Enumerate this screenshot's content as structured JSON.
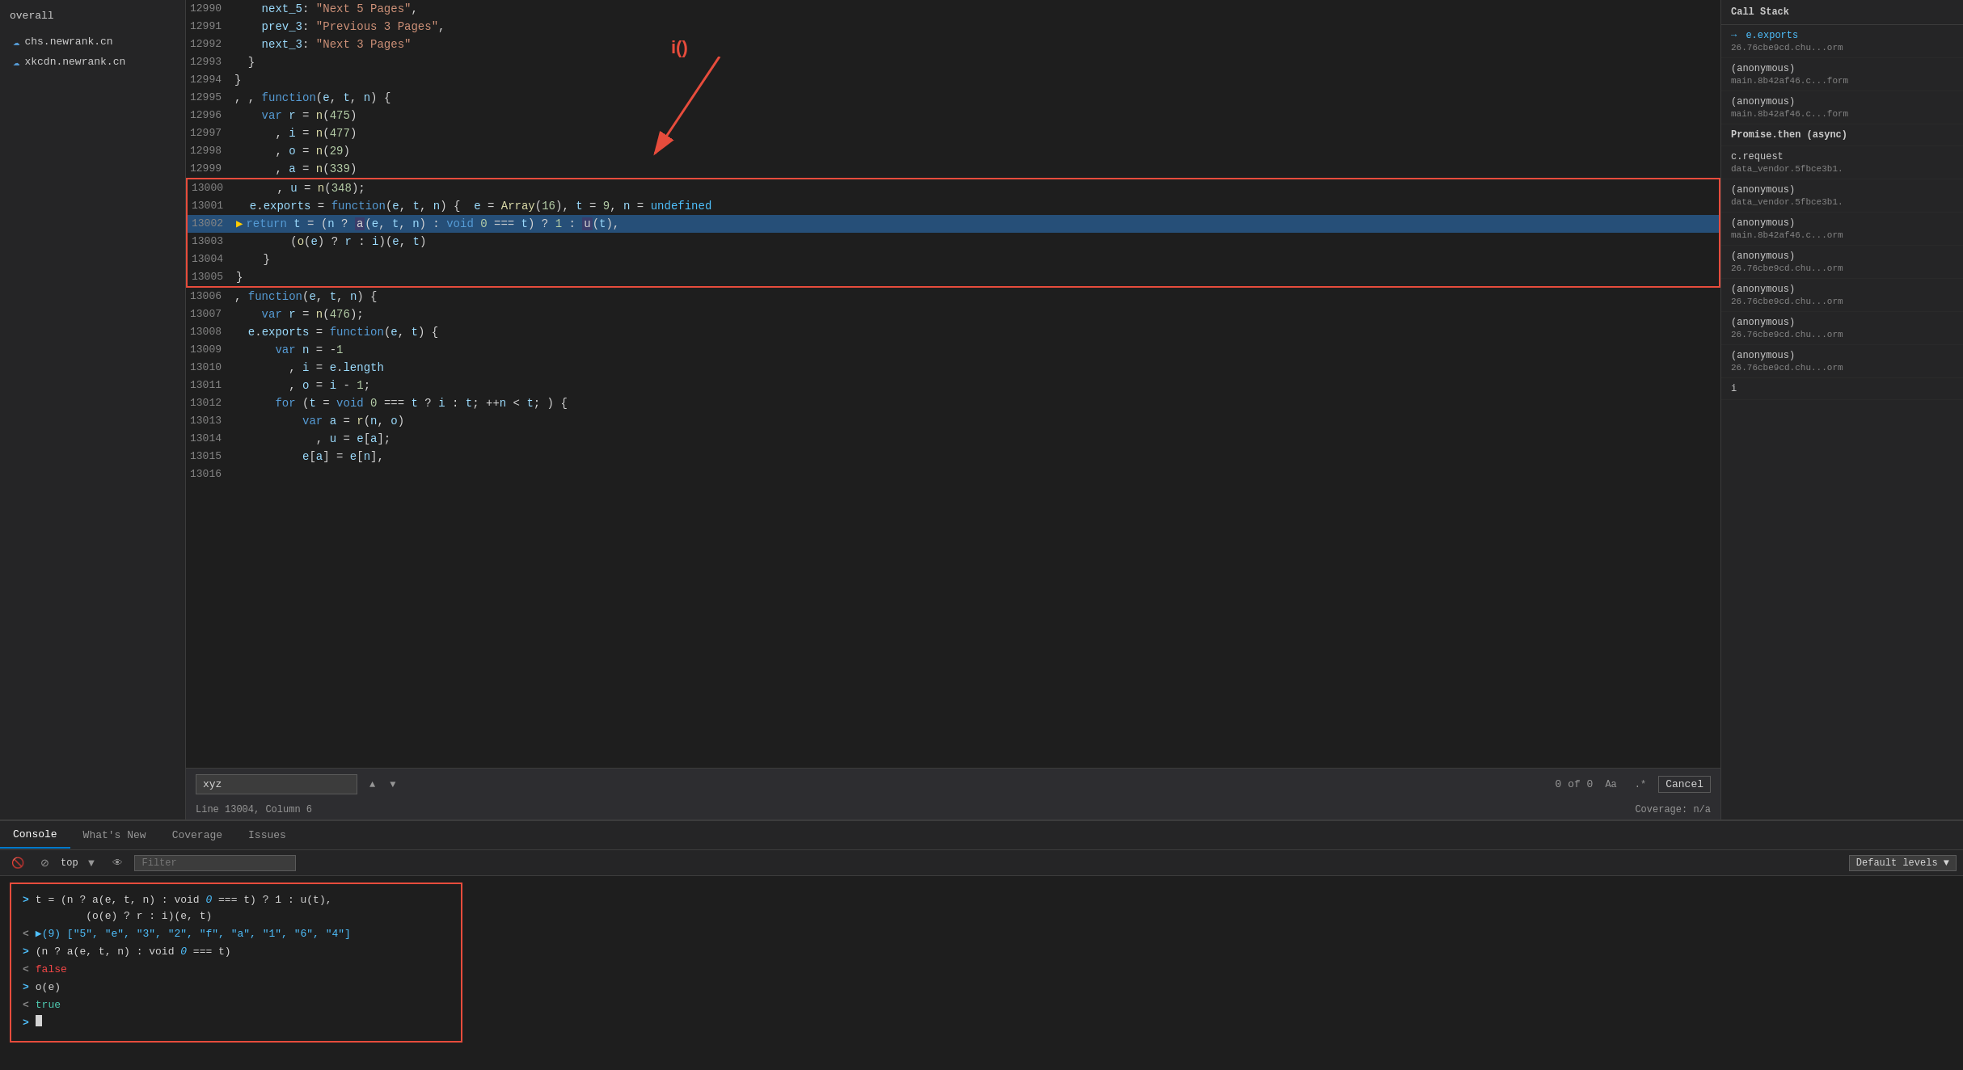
{
  "sidebar": {
    "overall_label": "overall",
    "items": [
      {
        "label": "chs.newrank.cn",
        "icon": "cloud"
      },
      {
        "label": "xkcdn.newrank.cn",
        "icon": "cloud"
      }
    ]
  },
  "editor": {
    "lines": [
      {
        "num": "12990",
        "content": "    next_5: \"Next 5 Pages\","
      },
      {
        "num": "12991",
        "content": "    prev_3: \"Previous 3 Pages\","
      },
      {
        "num": "12992",
        "content": "    next_3: \"Next 3 Pages\""
      },
      {
        "num": "12993",
        "content": "  }"
      },
      {
        "num": "12994",
        "content": "}"
      },
      {
        "num": "12995",
        "content": ", , function(e, t, n) {"
      },
      {
        "num": "12996",
        "content": "    var r = n(475)"
      },
      {
        "num": "12997",
        "content": "      , i = n(477)"
      },
      {
        "num": "12998",
        "content": "      , o = n(29)"
      },
      {
        "num": "12999",
        "content": "      , a = n(339)"
      },
      {
        "num": "13000",
        "content": "      , u = n(348);",
        "boxed": "top"
      },
      {
        "num": "13001",
        "content": "  e.exports = function(e, t, n) {  e = Array(16), t = 9, n = undefined",
        "boxed": "mid"
      },
      {
        "num": "13002",
        "content": "        return t = (n ? a(e, t, n) : void 0 === t) ? 1 : u(t),",
        "highlighted": true,
        "boxed": "mid"
      },
      {
        "num": "13003",
        "content": "        (o(e) ? r : i)(e, t)",
        "boxed": "mid"
      },
      {
        "num": "13004",
        "content": "    }",
        "boxed": "mid"
      },
      {
        "num": "13005",
        "content": "}",
        "boxed": "bottom"
      },
      {
        "num": "13006",
        "content": ", function(e, t, n) {"
      },
      {
        "num": "13007",
        "content": "    var r = n(476);"
      },
      {
        "num": "13008",
        "content": "  e.exports = function(e, t) {"
      },
      {
        "num": "13009",
        "content": "      var n = -1"
      },
      {
        "num": "13010",
        "content": "        , i = e.length"
      },
      {
        "num": "13011",
        "content": "        , o = i - 1;"
      },
      {
        "num": "13012",
        "content": "      for (t = void 0 === t ? i : t; ++n < t; ) {"
      },
      {
        "num": "13013",
        "content": "          var a = r(n, o)"
      },
      {
        "num": "13014",
        "content": "            , u = e[a];"
      },
      {
        "num": "13015",
        "content": "          e[a] = e[n],"
      },
      {
        "num": "13016",
        "content": ""
      }
    ],
    "annotation_label": "i()"
  },
  "search_bar": {
    "query": "xyz",
    "results": "0 of 0",
    "aa_label": "Aa",
    "regex_label": ".*",
    "cancel_label": "Cancel",
    "nav_up": "▲",
    "nav_down": "▼"
  },
  "status_bar": {
    "position": "Line 13004, Column 6",
    "coverage": "Coverage: n/a"
  },
  "call_stack": {
    "header": "Call Stack",
    "items": [
      {
        "name": "e.exports",
        "location": "26.76cbe9cd.chu...orm",
        "active": true
      },
      {
        "name": "(anonymous)",
        "location": "main.8b42af46.c...form"
      },
      {
        "name": "(anonymous)",
        "location": "main.8b42af46.c...form"
      },
      {
        "name": "Promise.then (async)",
        "bold": true
      },
      {
        "name": "c.request",
        "location": "data_vendor.5fbce3b1."
      },
      {
        "name": "(anonymous)",
        "location": "data_vendor.5fbce3b1."
      },
      {
        "name": "(anonymous)",
        "location": "main.8b42af46.c...orm"
      },
      {
        "name": "(anonymous)",
        "location": "26.76cbe9cd.chu...orm"
      },
      {
        "name": "(anonymous)",
        "location": "26.76cbe9cd.chu...orm"
      },
      {
        "name": "(anonymous)",
        "location": "26.76cbe9cd.chu...orm"
      },
      {
        "name": "(anonymous)",
        "location": "26.76cbe9cd.chu...orm"
      },
      {
        "name": "i"
      }
    ]
  },
  "bottom_tabs": [
    {
      "label": "Console",
      "active": true
    },
    {
      "label": "What's New",
      "active": false
    },
    {
      "label": "Coverage",
      "active": false
    },
    {
      "label": "Issues",
      "active": false
    }
  ],
  "console_toolbar": {
    "top_value": "top",
    "filter_placeholder": "Filter",
    "levels_label": "Default levels ▼"
  },
  "console": {
    "entries": [
      {
        "prefix": ">",
        "type": "input",
        "text": "t = (n ? a(e, t, n) : void 0 === t) ? 1 : u(t),\n        (o(e) ? r : i)(e, t)"
      },
      {
        "prefix": "<",
        "type": "output",
        "text": "▶(9) [\"5\", \"e\", \"3\", \"2\", \"f\", \"a\", \"1\", \"6\", \"4\"]"
      },
      {
        "prefix": ">",
        "type": "input",
        "text": "(n ? a(e, t, n) : void 0 === t)"
      },
      {
        "prefix": "<",
        "type": "output",
        "text": "false",
        "style": "false"
      },
      {
        "prefix": ">",
        "type": "input",
        "text": "o(e)"
      },
      {
        "prefix": "<",
        "type": "output",
        "text": "true",
        "style": "true"
      },
      {
        "prefix": ">",
        "type": "cursor"
      }
    ]
  }
}
